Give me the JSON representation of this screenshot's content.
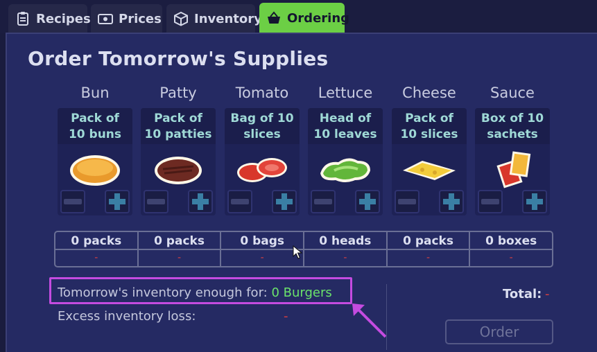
{
  "tabs": [
    {
      "label": "Recipes",
      "icon": "clipboard-icon",
      "active": false
    },
    {
      "label": "Prices",
      "icon": "money-icon",
      "active": false
    },
    {
      "label": "Inventory",
      "icon": "box-icon",
      "active": false
    },
    {
      "label": "Ordering",
      "icon": "basket-icon",
      "active": true
    }
  ],
  "title": "Order Tomorrow's Supplies",
  "ingredients": [
    {
      "name": "Bun",
      "pack": "Pack of\n10 buns",
      "icon": "bun-icon",
      "quantity": "0 packs",
      "cost": "-"
    },
    {
      "name": "Patty",
      "pack": "Pack of\n10 patties",
      "icon": "patty-icon",
      "quantity": "0 packs",
      "cost": "-"
    },
    {
      "name": "Tomato",
      "pack": "Bag of 10\nslices",
      "icon": "tomato-icon",
      "quantity": "0 bags",
      "cost": "-"
    },
    {
      "name": "Lettuce",
      "pack": "Head of\n10 leaves",
      "icon": "lettuce-icon",
      "quantity": "0 heads",
      "cost": "-"
    },
    {
      "name": "Cheese",
      "pack": "Pack of\n10 slices",
      "icon": "cheese-icon",
      "quantity": "0 packs",
      "cost": "-"
    },
    {
      "name": "Sauce",
      "pack": "Box of 10\nsachets",
      "icon": "sauce-icon",
      "quantity": "0 boxes",
      "cost": "-"
    }
  ],
  "summary": {
    "enough_label": "Tomorrow's inventory enough for:",
    "enough_value": "0 Burgers",
    "loss_label": "Excess inventory loss:",
    "loss_value": "-",
    "total_label": "Total:",
    "total_value": "-",
    "order_button": "Order"
  },
  "colors": {
    "accent_green": "#6ccf45",
    "highlight": "#c44be0",
    "negative": "#d84040"
  }
}
